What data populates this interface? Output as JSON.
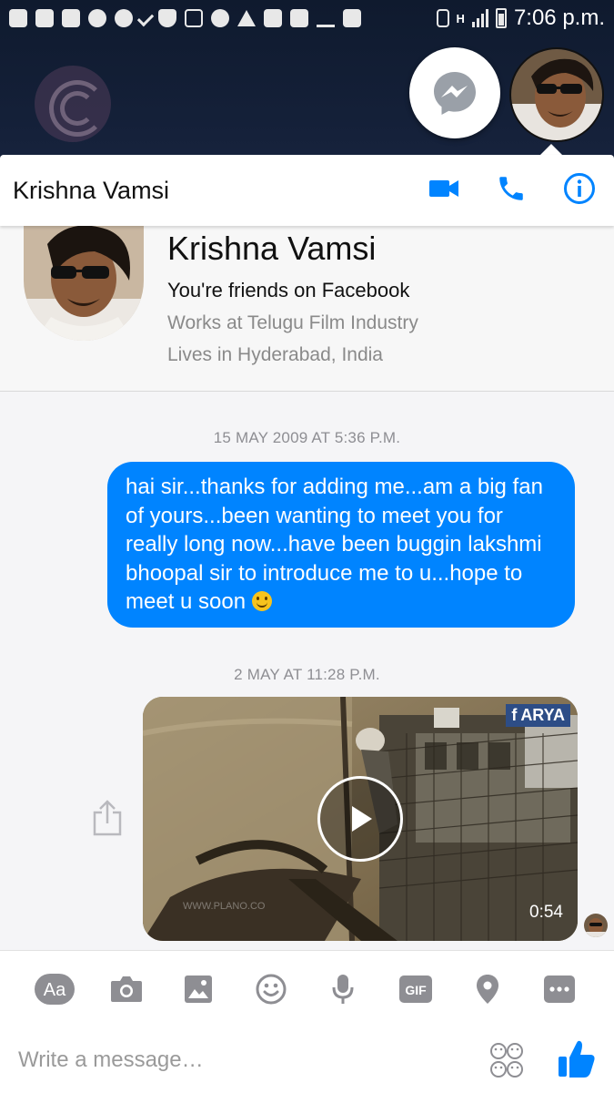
{
  "status_bar": {
    "time": "7:06 p.m.",
    "network": "H"
  },
  "chat_heads": {
    "messenger_icon": "messenger-icon",
    "avatar_icon": "contact-avatar"
  },
  "header": {
    "title": "Krishna Vamsi",
    "actions": [
      "video-call-icon",
      "phone-icon",
      "info-icon"
    ]
  },
  "profile": {
    "name": "Krishna Vamsi",
    "relation": "You're friends on Facebook",
    "work": "Works at Telugu Film Industry",
    "location": "Lives in Hyderabad, India"
  },
  "messages": [
    {
      "timestamp": "15 MAY 2009 AT 5:36 P.M.",
      "text": "hai sir...thanks for adding me...am a big fan of yours...been wanting to meet you for really long now...have been buggin lakshmi bhoopal sir to introduce me to u...hope to meet u soon",
      "emoji": "slight-smile"
    },
    {
      "timestamp": "2 MAY AT 11:28 P.M.",
      "video": {
        "badge": "ARYA",
        "badge_prefix": "f",
        "duration": "0:54",
        "watermark": "WWW.PLANO.CO"
      }
    }
  ],
  "composer": {
    "tools": [
      "text-format-icon",
      "camera-icon",
      "gallery-icon",
      "emoji-icon",
      "microphone-icon",
      "gif-icon",
      "location-icon",
      "more-icon"
    ],
    "aa_label": "Aa",
    "gif_label": "GIF",
    "placeholder": "Write a message…"
  },
  "colors": {
    "brand_blue": "#0084ff",
    "header_icon_blue": "#0084ff",
    "bg_dark": "#15213a"
  }
}
